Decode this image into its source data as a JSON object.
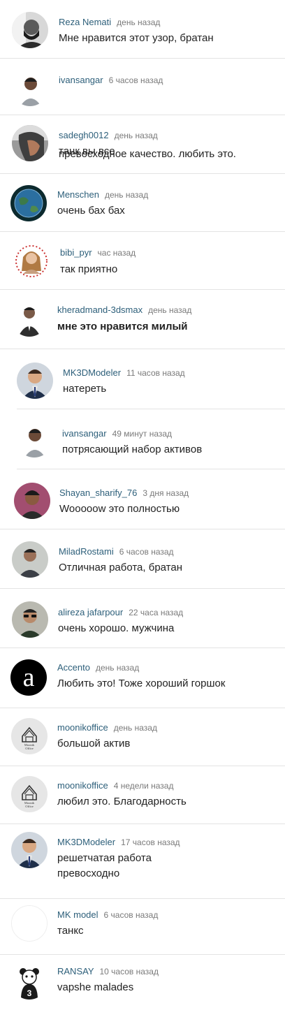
{
  "comments": [
    {
      "author": "Reza Nemati",
      "time": "день назад",
      "text": "Мне нравится этот узор, братан",
      "avatar_icon": "man-beard-portrait-icon"
    },
    {
      "author": "ivansangar",
      "time": "6 часов назад",
      "text": "превосходное качество. любить это.",
      "avatar_icon": "man-portrait-icon"
    },
    {
      "author": "sadegh0012",
      "time": "день назад",
      "text": "танк вы все",
      "avatar_icon": "man-profile-portrait-icon"
    },
    {
      "author": "Menschen",
      "time": "день назад",
      "text": "очень бах бах",
      "avatar_icon": "earth-globe-icon"
    },
    {
      "author": "bibi_pyr",
      "time": "час назад",
      "text": "так приятно",
      "avatar_icon": "woman-portrait-icon"
    },
    {
      "author": "kheradmand-3dsmax",
      "time": "день назад",
      "text": "мне это нравится милый",
      "avatar_icon": "man-suit-portrait-icon"
    },
    {
      "author": "MK3DModeler",
      "time": "11 часов назад",
      "text": "натереть",
      "avatar_icon": "man-tie-portrait-icon"
    },
    {
      "author": "ivansangar",
      "time": "49 минут назад",
      "text": "потрясающий набор активов",
      "avatar_icon": "man-portrait-icon"
    },
    {
      "author": "Shayan_sharify_76",
      "time": "3 дня назад",
      "text": "Wooooow это полностью",
      "avatar_icon": "young-man-portrait-icon"
    },
    {
      "author": "MiladRostami",
      "time": "6 часов назад",
      "text": "Отличная работа, братан",
      "avatar_icon": "man-portrait-icon"
    },
    {
      "author": "alireza jafarpour",
      "time": "22 часа назад",
      "text": "очень хорошо. мужчина",
      "avatar_icon": "man-sunglasses-portrait-icon"
    },
    {
      "author": "Accento",
      "time": "день назад",
      "text": "Любить это! Тоже хороший горшок",
      "avatar_icon": "letter-a-logo-icon"
    },
    {
      "author": "moonikoffice",
      "time": "день назад",
      "text": "большой актив",
      "avatar_icon": "house-logo-icon"
    },
    {
      "author": "moonikoffice",
      "time": "4 недели назад",
      "text": "любил это. Благодарность",
      "avatar_icon": "house-logo-icon"
    },
    {
      "author": "MK3DModeler",
      "time": "17 часов назад",
      "text": "решетчатая работа",
      "text2": "превосходно",
      "avatar_icon": "man-tie-portrait-icon"
    },
    {
      "author": "MK model",
      "time": "6 часов назад",
      "text": "танкс",
      "avatar_icon": "blank-avatar-icon"
    },
    {
      "author": "RANSAY",
      "time": "10 часов назад",
      "text": "vapshe malades",
      "avatar_icon": "bear-number-3-icon"
    }
  ],
  "avatar_logos": {
    "house_logo_line1": "Moonik",
    "house_logo_line2": "Office"
  },
  "colors": {
    "author": "#2d5f7a",
    "time": "#7a7a7a",
    "text": "#222222",
    "divider": "#e3e3e3"
  }
}
